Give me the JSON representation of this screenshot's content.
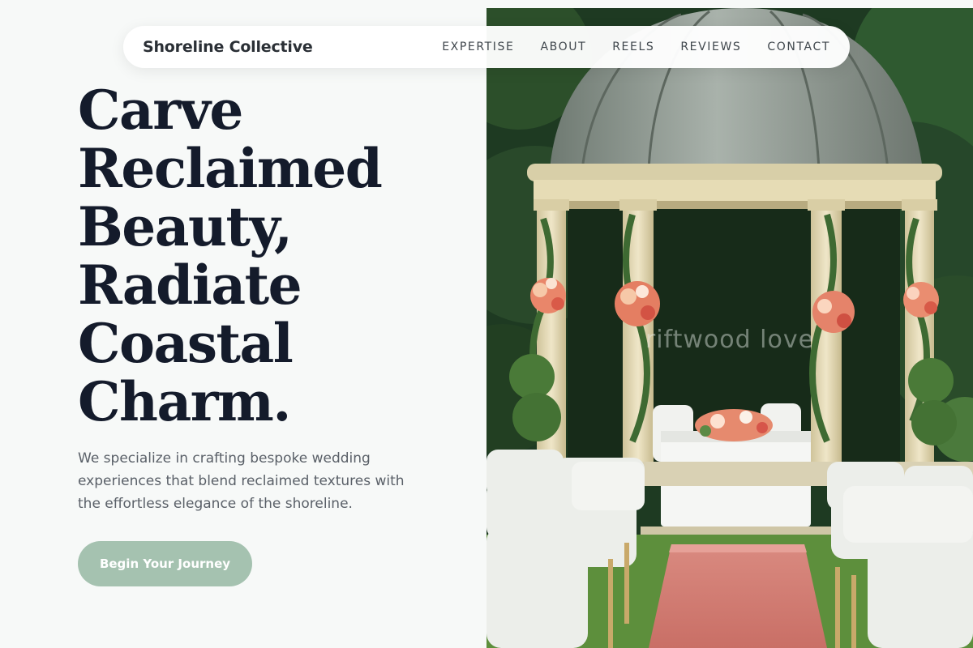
{
  "brand": {
    "name": "Shoreline Collective"
  },
  "nav": {
    "items": [
      {
        "label": "EXPERTISE"
      },
      {
        "label": "ABOUT"
      },
      {
        "label": "REELS"
      },
      {
        "label": "REVIEWS"
      },
      {
        "label": "CONTACT"
      }
    ]
  },
  "hero": {
    "headline_lines": [
      "Carve",
      "Reclaimed",
      "Beauty,",
      "Radiate",
      "Coastal",
      "Charm."
    ],
    "subtext": "We specialize in crafting bespoke wedding experiences that blend reclaimed textures with the effortless elegance of the shoreline.",
    "cta_label": "Begin Your Journey",
    "image_watermark": "riftwood love"
  },
  "colors": {
    "page_background": "#f7f9f8",
    "headline": "#141b2b",
    "body_text": "#5a6068",
    "cta_background": "#a5c2b0",
    "cta_text": "#ffffff",
    "nav_background": "#ffffff"
  }
}
